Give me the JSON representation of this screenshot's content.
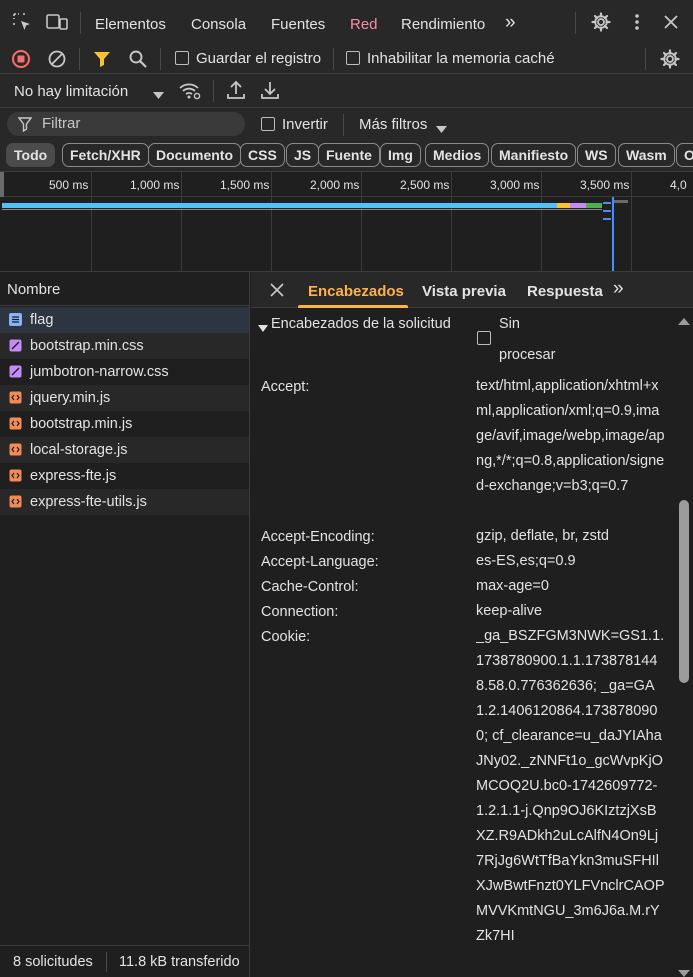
{
  "toolbar": {
    "tabs": [
      "Elementos",
      "Consola",
      "Fuentes",
      "Red",
      "Rendimiento"
    ],
    "active_tab": "Red",
    "overflow": "»",
    "icons": [
      "inspect-icon",
      "device-toolbar-icon",
      "gear-icon",
      "kebab-menu-icon",
      "close-icon"
    ]
  },
  "network_controls": {
    "preserve_log_label": "Guardar el registro",
    "disable_cache_label": "Inhabilitar la memoria caché",
    "throttling_value": "No hay limitación"
  },
  "filter_bar": {
    "placeholder": "Filtrar",
    "invert_label": "Invertir",
    "more_filters_label": "Más filtros"
  },
  "type_filters": [
    "Todo",
    "Fetch/XHR",
    "Documento",
    "CSS",
    "JS",
    "Fuente",
    "Img",
    "Medios",
    "Manifiesto",
    "WS",
    "Wasm",
    "O"
  ],
  "active_type_filter": "Todo",
  "timeline": {
    "ticks": [
      "500 ms",
      "1,000 ms",
      "1,500 ms",
      "2,000 ms",
      "2,500 ms",
      "3,000 ms",
      "3,500 ms",
      "4,0"
    ],
    "colors": {
      "waiting": "#4fc3f7",
      "script": "#f9c22e",
      "css": "#c58af9",
      "other": "#4caf50",
      "marker": "#4a8cff"
    }
  },
  "request_list": {
    "column_header": "Nombre",
    "files": [
      {
        "name": "flag",
        "type": "document"
      },
      {
        "name": "bootstrap.min.css",
        "type": "stylesheet"
      },
      {
        "name": "jumbotron-narrow.css",
        "type": "stylesheet"
      },
      {
        "name": "jquery.min.js",
        "type": "script"
      },
      {
        "name": "bootstrap.min.js",
        "type": "script"
      },
      {
        "name": "local-storage.js",
        "type": "script"
      },
      {
        "name": "express-fte.js",
        "type": "script"
      },
      {
        "name": "express-fte-utils.js",
        "type": "script"
      }
    ],
    "status_requests": "8 solicitudes",
    "status_transferred": "11.8 kB transferido"
  },
  "details": {
    "tabs": [
      "Encabezados",
      "Vista previa",
      "Respuesta"
    ],
    "active_tab": "Encabezados",
    "overflow": "»",
    "section_title": "Encabezados de la solicitud",
    "raw_label_line1": "Sin",
    "raw_label_line2": "procesar",
    "headers": [
      {
        "name": "Accept:",
        "value": "text/html,application/xhtml+xml,application/xml;q=0.9,image/avif,image/webp,image/apng,*/*;q=0.8,application/signed-exchange;v=b3;q=0.7"
      },
      {
        "name": "Accept-Encoding:",
        "value": "gzip, deflate, br, zstd"
      },
      {
        "name": "Accept-Language:",
        "value": "es-ES,es;q=0.9"
      },
      {
        "name": "Cache-Control:",
        "value": "max-age=0"
      },
      {
        "name": "Connection:",
        "value": "keep-alive"
      },
      {
        "name": "Cookie:",
        "value": "_ga_BSZFGM3NWK=GS1.1.1738780900.1.1.1738781448.58.0.776362636; _ga=GA1.2.1406120864.1738780900; cf_clearance=u_daJYIAhaJNy02._zNNFt1o_gcWvpKjOMCOQ2U.bc0-1742609772-1.2.1.1-j.Qnp9OJ6KIztzjXsBXZ.R9ADkh2uLcAlfN4On9Lj7RjJg6WtTfBaYkn3muSFHIlXJwBwtFnzt0YLFVnclrCAOPMVVKmtNGU_3m6J6a.M.rYZk7HI"
      }
    ]
  }
}
